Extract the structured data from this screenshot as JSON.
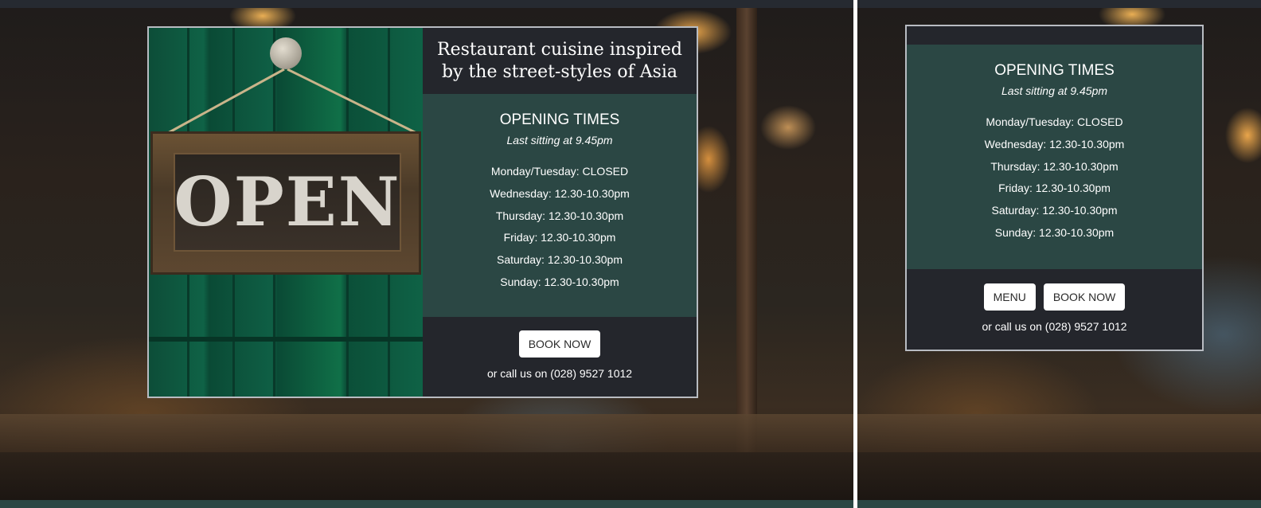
{
  "hero": {
    "heading_line1": "Restaurant cuisine inspired",
    "heading_line2": "by the street-styles of Asia",
    "sign_text": "OPEN"
  },
  "opening_times": {
    "title": "OPENING TIMES",
    "subtitle": "Last sitting at 9.45pm",
    "days": [
      "Monday/Tuesday: CLOSED",
      "Wednesday: 12.30-10.30pm",
      "Thursday: 12.30-10.30pm",
      "Friday: 12.30-10.30pm",
      "Saturday: 12.30-10.30pm",
      "Sunday: 12.30-10.30pm"
    ]
  },
  "actions": {
    "menu_label": "MENU",
    "book_label": "BOOK NOW",
    "call_text": "or call us on (028) 9527 1012"
  },
  "colors": {
    "dark_band": "#24262c",
    "teal_panel": "#2b4744",
    "button_bg": "#ffffff"
  }
}
